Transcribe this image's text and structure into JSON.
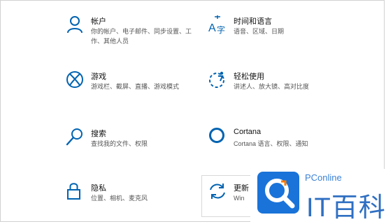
{
  "settings": {
    "tiles": [
      {
        "title": "帐户",
        "desc": "你的帐户、电子邮件、同步设置、工作、其他人员",
        "icon": "person-icon"
      },
      {
        "title": "时间和语言",
        "desc": "语音、区域、日期",
        "icon": "time-language-icon"
      },
      {
        "title": "游戏",
        "desc": "游戏栏、截屏、直播、游戏模式",
        "icon": "xbox-icon"
      },
      {
        "title": "轻松使用",
        "desc": "讲述人、放大镜、高对比度",
        "icon": "ease-of-access-icon"
      },
      {
        "title": "搜索",
        "desc": "查找我的文件、权限",
        "icon": "search-icon"
      },
      {
        "title": "Cortana",
        "desc": "Cortana 语言、权限、通知",
        "icon": "cortana-icon"
      },
      {
        "title": "隐私",
        "desc": "位置、相机、麦克风",
        "icon": "lock-icon"
      },
      {
        "title": "更新",
        "desc": "Win",
        "icon": "update-icon"
      }
    ],
    "accent_color": "#0063b1"
  },
  "watermark": {
    "brand_small": "PConline",
    "brand_large": "IT百科"
  }
}
